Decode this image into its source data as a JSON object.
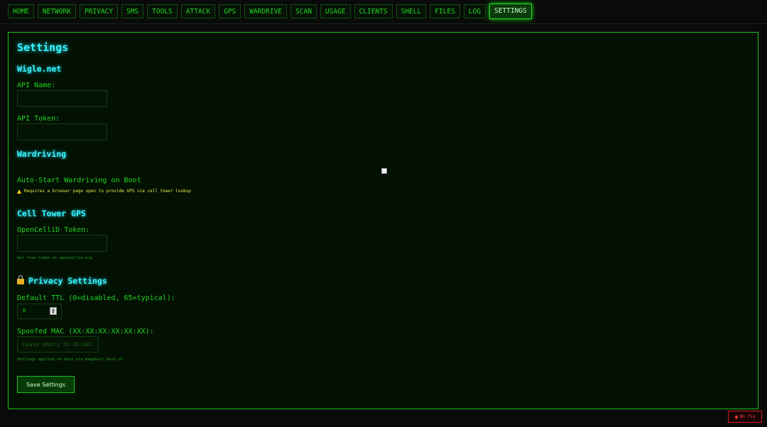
{
  "nav": {
    "tabs": [
      {
        "label": "HOME"
      },
      {
        "label": "NETWORK"
      },
      {
        "label": "PRIVACY"
      },
      {
        "label": "SMS"
      },
      {
        "label": "TOOLS"
      },
      {
        "label": "ATTACK"
      },
      {
        "label": "GPS"
      },
      {
        "label": "WARDRIVE"
      },
      {
        "label": "SCAN"
      },
      {
        "label": "USAGE"
      },
      {
        "label": "CLIENTS"
      },
      {
        "label": "SHELL"
      },
      {
        "label": "FILES"
      },
      {
        "label": "LOG"
      },
      {
        "label": "SETTINGS"
      }
    ],
    "active": "SETTINGS"
  },
  "page": {
    "title": "Settings"
  },
  "wigle": {
    "title": "Wigle.net",
    "api_name_label": "API Name:",
    "api_name_value": "",
    "api_token_label": "API Token:",
    "api_token_value": ""
  },
  "wardriving": {
    "title": "Wardriving",
    "autostart_label": "Auto-Start Wardriving on Boot",
    "autostart_checked": false,
    "warning": "Requires a browser page open to provide GPS via cell tower lookup"
  },
  "cell_tower": {
    "title": "Cell Tower GPS",
    "token_label": "OpenCelliD Token:",
    "token_value": "",
    "hint": "Get free token at opencellid.org"
  },
  "privacy": {
    "title": "Privacy Settings",
    "ttl_label": "Default TTL (0=disabled, 65=typical):",
    "ttl_value": "0",
    "mac_label": "Spoofed MAC (XX:XX:XX:XX:XX:XX):",
    "mac_placeholder": "Leave empty to disable",
    "hint": "Settings applied on boot via dagshell_boot.sh"
  },
  "actions": {
    "save_label": "Save Settings"
  },
  "status": {
    "gps_fix": "No fix"
  },
  "icons": {
    "warning": "warning-icon",
    "lock": "lock-icon",
    "pin": "pin-icon"
  },
  "colors": {
    "accent_green": "#1fd81f",
    "title_cyan": "#39f3ff",
    "warning_yellow": "#e8e84a",
    "error_red": "#ff3a3a"
  }
}
